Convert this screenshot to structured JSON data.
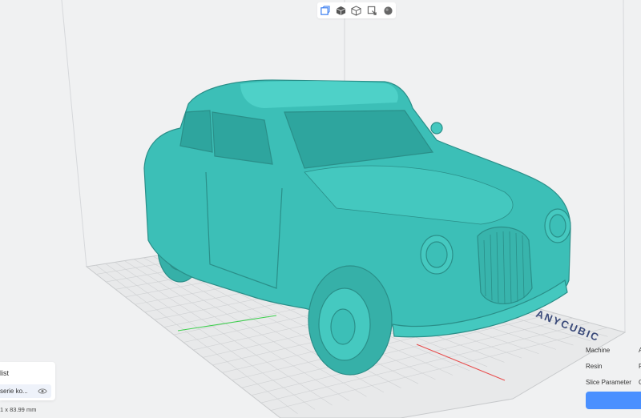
{
  "toolbar": {
    "buttons": [
      {
        "name": "view-front-icon",
        "color": "#3b7ef0"
      },
      {
        "name": "view-cube-solid-icon",
        "color": "#555555"
      },
      {
        "name": "view-cube-wire-icon",
        "color": "#555555"
      },
      {
        "name": "select-box-icon",
        "color": "#555555"
      },
      {
        "name": "sphere-render-icon",
        "color": "#666666"
      }
    ]
  },
  "scene": {
    "model_color": "#3cbfb7",
    "platform_watermark": "ANYCUBIC",
    "axis_x_color": "#e84c4c",
    "axis_y_color": "#3fcf4f"
  },
  "model_panel": {
    "title": "list",
    "items": [
      {
        "label": "serie ko..."
      }
    ],
    "dimensions": "1 x 83.99 mm"
  },
  "settings": {
    "machine_label": "Machine",
    "machine_value": "A",
    "resin_label": "Resin",
    "resin_value": "F",
    "slice_param_label": "Slice Parameter",
    "slice_param_value": "C",
    "slice_button": ""
  },
  "colors": {
    "background": "#f0f1f2",
    "accent": "#4a90ff",
    "panel": "#ffffff"
  }
}
